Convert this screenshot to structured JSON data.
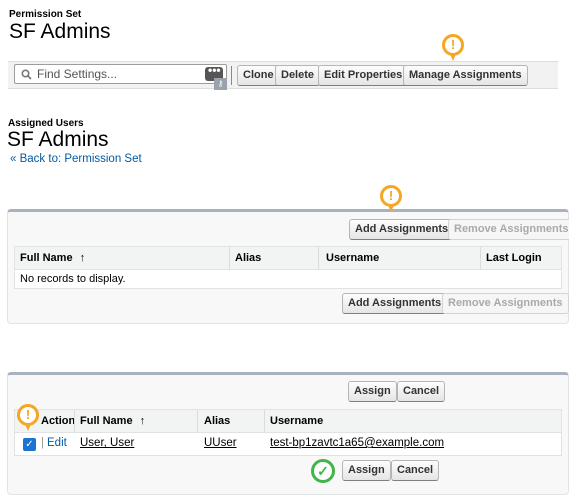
{
  "header": {
    "label": "Permission Set",
    "title": "SF Admins"
  },
  "toolbar": {
    "search_placeholder": "Find Settings...",
    "clone": "Clone",
    "delete": "Delete",
    "edit_properties": "Edit Properties",
    "manage_assignments": "Manage Assignments"
  },
  "assigned": {
    "label": "Assigned Users",
    "title": "SF Admins",
    "back_prefix": "«",
    "back_link": "Back to: Permission Set"
  },
  "assigned_table": {
    "add_assignments": "Add Assignments",
    "remove_assignments": "Remove Assignments",
    "columns": [
      "Full Name",
      "Alias",
      "Username",
      "Last Login"
    ],
    "sort_arrow": "↑",
    "empty": "No records to display."
  },
  "assign_table": {
    "assign": "Assign",
    "cancel": "Cancel",
    "columns": [
      "Action",
      "Full Name",
      "Alias",
      "Username"
    ],
    "sort_arrow": "↑",
    "rows": [
      {
        "action": "Edit",
        "full_name": "User, User",
        "alias": "UUser",
        "username": "test-bp1zavtc1a65@example.com",
        "checked": true
      }
    ]
  },
  "markers": {
    "warning": "!",
    "check": "✓"
  },
  "colors": {
    "warning": "#f5a623",
    "success": "#41b549",
    "link": "#015ba7"
  }
}
